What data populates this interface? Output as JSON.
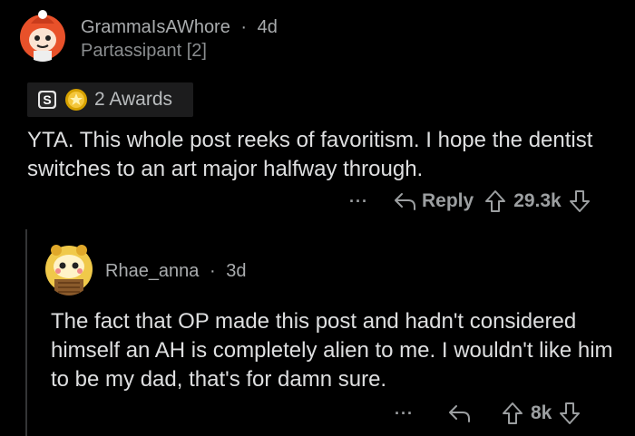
{
  "comment": {
    "username": "GrammaIsAWhore",
    "separator": "·",
    "age": "4d",
    "flair": "Partassipant [2]",
    "awards_label": "2 Awards",
    "body": "YTA. This whole post reeks of favoritism. I hope the dentist switches to an art major halfway through.",
    "actions": {
      "more_label": "···",
      "reply_label": "Reply",
      "score": "29.3k"
    }
  },
  "reply": {
    "username": "Rhae_anna",
    "separator": "·",
    "age": "3d",
    "body": "The fact that OP made this post and hadn't considered himself an AH is completely alien to me. I wouldn't like him to be my dad, that's for damn sure.",
    "actions": {
      "more_label": "···",
      "score": "8k"
    }
  },
  "colors": {
    "background": "#000000",
    "text": "#dedfe0",
    "muted": "#a9acae",
    "awards_bg": "#1c1c1d",
    "avatar_1_accent": "#e8512a",
    "avatar_2_accent": "#f0c94a"
  },
  "icons": {
    "award_1": "silver-s-award-icon",
    "award_2": "gold-award-icon",
    "reply": "reply-arrow-icon",
    "upvote": "upvote-arrow-icon",
    "downvote": "downvote-arrow-icon"
  }
}
